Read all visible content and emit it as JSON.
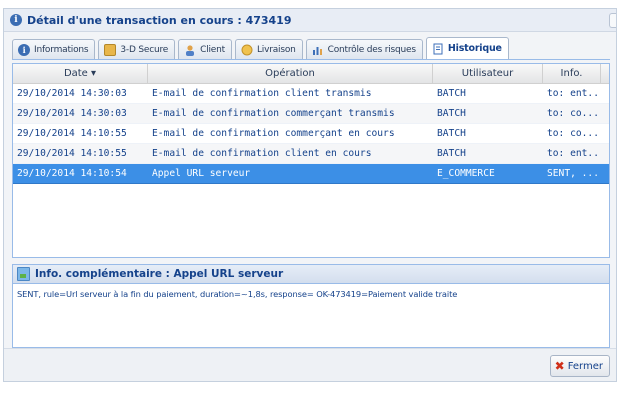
{
  "window": {
    "title": "Détail d'une transaction en cours : 473419"
  },
  "tabs": [
    {
      "label": "Informations",
      "icon": "info-icon",
      "active": false
    },
    {
      "label": "3-D Secure",
      "icon": "3d-secure-icon",
      "active": false
    },
    {
      "label": "Client",
      "icon": "client-icon",
      "active": false
    },
    {
      "label": "Livraison",
      "icon": "delivery-icon",
      "active": false
    },
    {
      "label": "Contrôle des risques",
      "icon": "risk-control-icon",
      "active": false
    },
    {
      "label": "Historique",
      "icon": "history-icon",
      "active": true
    }
  ],
  "grid": {
    "columns": [
      "Date ▾",
      "Opération",
      "Utilisateur",
      "Info."
    ],
    "rows": [
      [
        "29/10/2014 14:30:03",
        "E-mail de confirmation client transmis",
        "BATCH",
        "to: ent..."
      ],
      [
        "29/10/2014 14:30:03",
        "E-mail de confirmation commerçant transmis",
        "BATCH",
        "to: co..."
      ],
      [
        "29/10/2014 14:10:55",
        "E-mail de confirmation commerçant en cours",
        "BATCH",
        "to: co..."
      ],
      [
        "29/10/2014 14:10:55",
        "E-mail de confirmation client en cours",
        "BATCH",
        "to: ent..."
      ],
      [
        "29/10/2014 14:10:54",
        "Appel URL serveur",
        "E_COMMERCE",
        "SENT, ..."
      ]
    ]
  },
  "info_panel": {
    "title": "Info. complémentaire : Appel URL serveur",
    "text": "SENT, rule=Url serveur à la fin du paiement, duration=~1,8s, response= OK-473419=Paiement valide traite"
  },
  "footer": {
    "close_label": "Fermer"
  },
  "colors": {
    "accent": "#15428b",
    "selection": "#3c8fe6",
    "border": "#99bbe8"
  }
}
